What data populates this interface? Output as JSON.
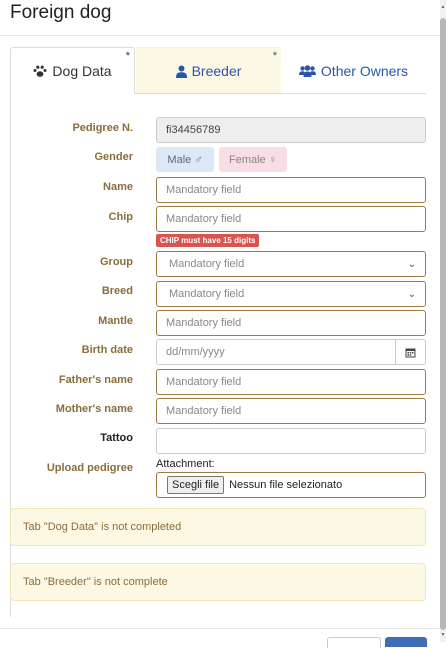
{
  "modal": {
    "title": "Foreign dog"
  },
  "tabs": {
    "dog_data": "Dog Data",
    "breeder": "Breeder",
    "other_owners": "Other Owners",
    "required_mark": "*"
  },
  "form": {
    "pedigree_label": "Pedigree N.",
    "pedigree_value": "fi34456789",
    "gender_label": "Gender",
    "male_label": "Male",
    "male_symbol": "♂",
    "female_label": "Female",
    "female_symbol": "♀",
    "name_label": "Name",
    "chip_label": "Chip",
    "chip_error": "CHIP must have 15 digits",
    "group_label": "Group",
    "breed_label": "Breed",
    "mantle_label": "Mantle",
    "birth_label": "Birth date",
    "birth_placeholder": "dd/mm/yyyy",
    "father_label": "Father's name",
    "mother_label": "Mother's name",
    "tattoo_label": "Tattoo",
    "upload_label": "Upload pedigree",
    "attachment_label": "Attachment:",
    "file_button": "Scegli file",
    "file_status": "Nessun file selezionato",
    "mandatory": "Mandatory field"
  },
  "alerts": [
    "Tab \"Dog Data\" is not completed",
    "Tab \"Breeder\" is not complete"
  ],
  "colors": {
    "label": "#8a6d3b",
    "accent": "#2a56a8",
    "warning_bg": "#fcf8e3",
    "error": "#d9534f"
  }
}
